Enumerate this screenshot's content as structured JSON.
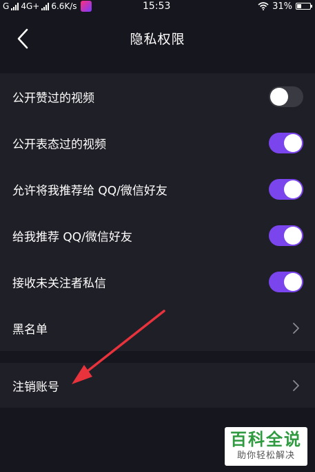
{
  "status_bar": {
    "network_left": "G",
    "network_right": "4G+",
    "speed": "6.6K/s",
    "time": "15:53",
    "battery_text": "31%",
    "battery_level": 0.31
  },
  "nav": {
    "title": "隐私权限"
  },
  "settings": {
    "public_liked_videos": {
      "label": "公开赞过的视频",
      "enabled": false
    },
    "public_reacted_videos": {
      "label": "公开表态过的视频",
      "enabled": true
    },
    "recommend_me_to_friends": {
      "label": "允许将我推荐给 QQ/微信好友",
      "enabled": true
    },
    "recommend_friends_to_me": {
      "label": "给我推荐 QQ/微信好友",
      "enabled": true
    },
    "receive_stranger_messages": {
      "label": "接收未关注者私信",
      "enabled": true
    },
    "blacklist": {
      "label": "黑名单"
    },
    "delete_account": {
      "label": "注销账号"
    }
  },
  "colors": {
    "background": "#16161e",
    "row_background": "#1f1f27",
    "toggle_on": "#7b45ee",
    "toggle_off": "#3a3a42",
    "annotation_arrow": "#e8333c",
    "watermark_green": "#2f9a3f"
  },
  "icons": {
    "back": "chevron-left-icon",
    "row_more": "chevron-right-icon",
    "wifi": "wifi-icon",
    "battery": "battery-icon",
    "signal": "signal-bars-icon"
  },
  "watermark": {
    "title": "百科全说",
    "subtitle": "助你轻松解决"
  }
}
